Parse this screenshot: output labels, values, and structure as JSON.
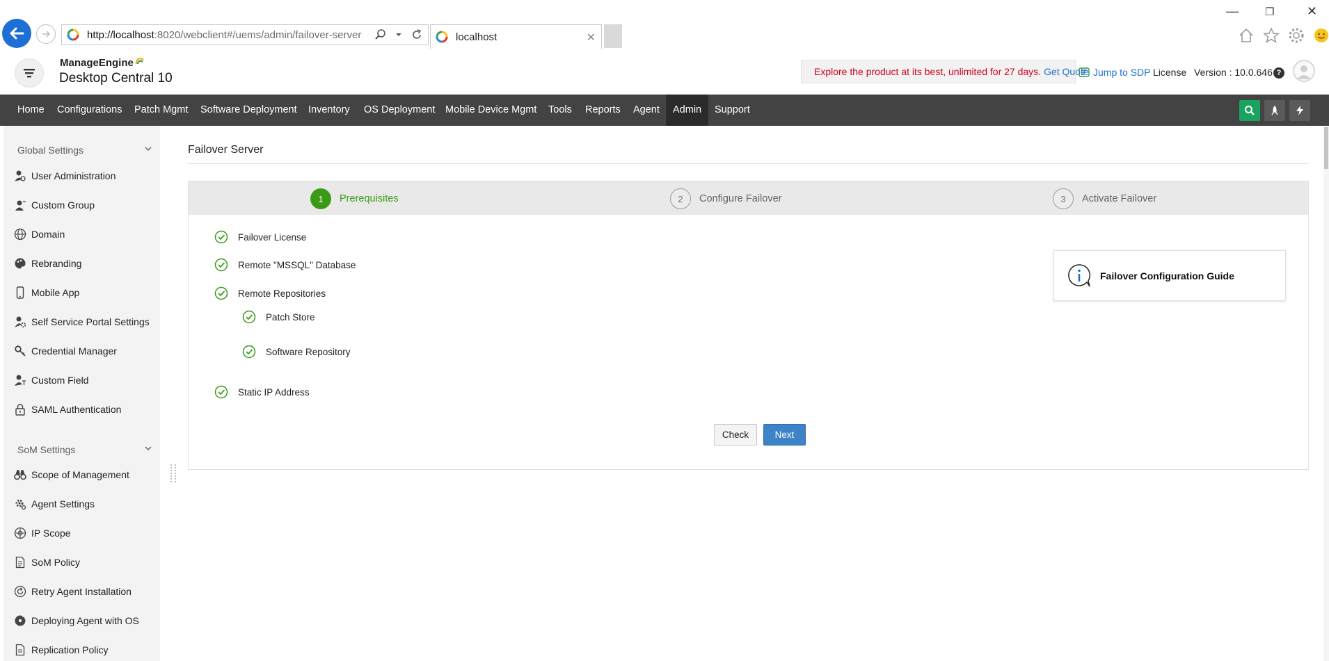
{
  "browser": {
    "url_host": "http://localhost",
    "url_rest": ":8020/webclient#/uems/admin/failover-server",
    "tab_title": "localhost"
  },
  "app": {
    "brand_top": "ManageEngine",
    "brand_main": "Desktop Central 10",
    "promo_text": "Explore the product at its best, unlimited for 27 days.",
    "promo_link": "Get Quote",
    "jump_sdp": "Jump to SDP",
    "license": "License",
    "version": "Version : 10.0.646",
    "help": "?"
  },
  "nav": {
    "items": [
      "Home",
      "Configurations",
      "Patch Mgmt",
      "Software Deployment",
      "Inventory",
      "OS Deployment",
      "Mobile Device Mgmt",
      "Tools",
      "Reports",
      "Agent",
      "Admin",
      "Support"
    ],
    "active": "Admin"
  },
  "sidebar": {
    "global_heading": "Global Settings",
    "global_items": [
      "User Administration",
      "Custom Group",
      "Domain",
      "Rebranding",
      "Mobile App",
      "Self Service Portal Settings",
      "Credential Manager",
      "Custom Field",
      "SAML Authentication"
    ],
    "som_heading": "SoM Settings",
    "som_items": [
      "Scope of Management",
      "Agent Settings",
      "IP Scope",
      "SoM Policy",
      "Retry Agent Installation",
      "Deploying Agent with OS",
      "Replication Policy"
    ]
  },
  "page": {
    "title": "Failover Server",
    "steps": [
      {
        "num": "1",
        "label": "Prerequisites",
        "state": "active"
      },
      {
        "num": "2",
        "label": "Configure Failover",
        "state": "todo"
      },
      {
        "num": "3",
        "label": "Activate Failover",
        "state": "todo"
      }
    ],
    "checks": [
      "Failover License",
      "Remote \"MSSQL\" Database",
      "Remote Repositories",
      "Patch Store",
      "Software Repository",
      "Static IP Address"
    ],
    "guide_title": "Failover Configuration Guide",
    "check_button": "Check",
    "next_button": "Next"
  },
  "colors": {
    "nav_bg": "#434343",
    "active_step": "#3a9a16",
    "primary_button": "#3c83c7",
    "promo_text": "#d0021b",
    "search_btn": "#1aa260"
  }
}
